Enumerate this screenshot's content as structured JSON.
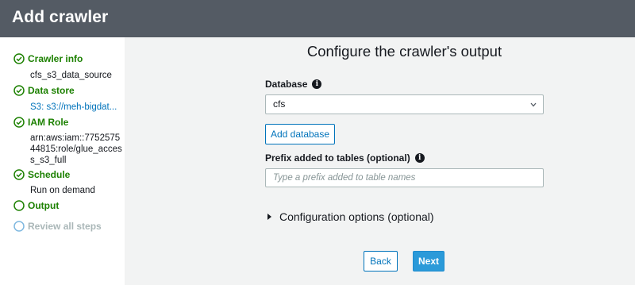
{
  "header": {
    "title": "Add crawler"
  },
  "steps": [
    {
      "label": "Crawler info",
      "status": "done",
      "detail": "cfs_s3_data_source"
    },
    {
      "label": "Data store",
      "status": "done",
      "detail": "S3: s3://meh-bigdat..."
    },
    {
      "label": "IAM Role",
      "status": "done",
      "detail": "arn:aws:iam::775257544815:role/glue_access_s3_full"
    },
    {
      "label": "Schedule",
      "status": "done",
      "detail": "Run on demand"
    },
    {
      "label": "Output",
      "status": "current"
    },
    {
      "label": "Review all steps",
      "status": "future"
    }
  ],
  "main": {
    "title": "Configure the crawler's output",
    "database": {
      "label": "Database",
      "value": "cfs"
    },
    "add_database_label": "Add database",
    "prefix": {
      "label": "Prefix added to tables (optional)",
      "placeholder": "Type a prefix added to table names",
      "value": ""
    },
    "config_options_label": "Configuration options (optional)"
  },
  "footer": {
    "back_label": "Back",
    "next_label": "Next"
  },
  "colors": {
    "success": "#1d8102",
    "link": "#0073bb",
    "primary": "#2b9ad9",
    "header_bg": "#545b64",
    "pending": "#7fb8e0"
  }
}
